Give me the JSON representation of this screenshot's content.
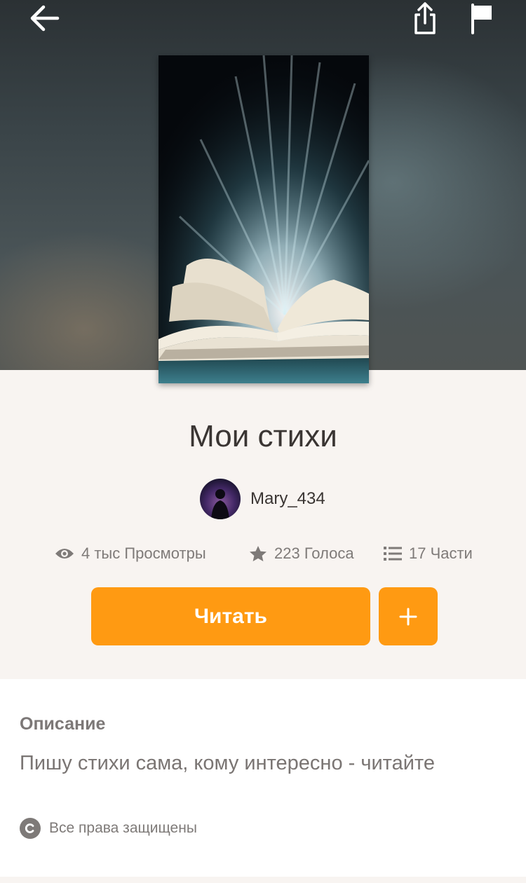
{
  "story": {
    "title": "Мои стихи",
    "author": "Mary_434"
  },
  "stats": {
    "views": "4 тыс Просмотры",
    "votes": "223 Голоса",
    "parts": "17 Части"
  },
  "actions": {
    "read_label": "Читать",
    "add_label": "+"
  },
  "description": {
    "heading": "Описание",
    "text": "Пишу стихи сама, кому интересно - читайте",
    "copyright": "Все права защищены"
  },
  "icons": {
    "back": "arrow-left-icon",
    "share": "share-icon",
    "report": "flag-icon",
    "views": "eye-icon",
    "votes": "star-icon",
    "parts": "list-icon",
    "copyright": "copyright-icon"
  },
  "colors": {
    "accent": "#ff9a12",
    "text_dark": "#3a3533",
    "text_muted": "#7e7a78",
    "page_bg": "#f8f4f1"
  }
}
